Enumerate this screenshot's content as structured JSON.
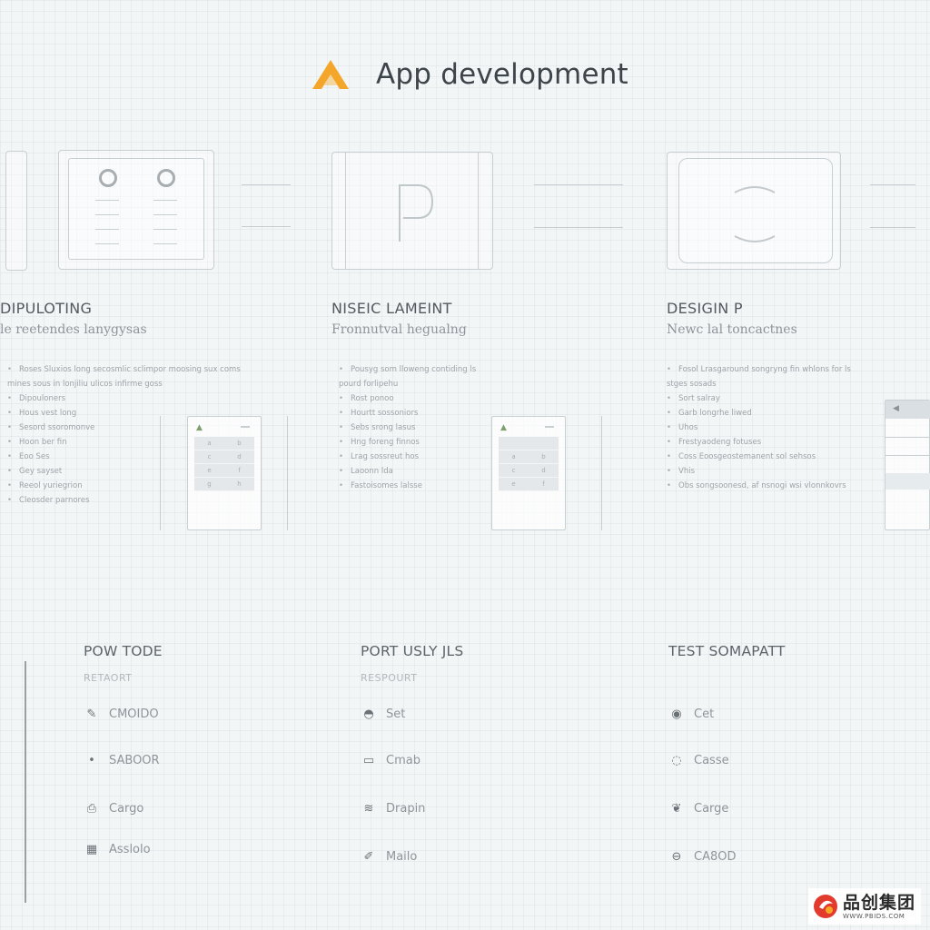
{
  "header": {
    "title": "App development",
    "logo_icon": "triangle-logo-icon",
    "accent": "#f4a62a"
  },
  "columns": [
    {
      "title": "DIPULOTING",
      "subtitle": "le reetendes lanygysas",
      "bullets": [
        "Roses Sluxios long secosmlic sclimpor moosing sux coms mines sous in lonjiliu ulicos infirme goss",
        "Dipouloners",
        "Hous vest long",
        "Sesord ssoromonve",
        "Hoon ber fin",
        "Eoo Ses",
        "Gey sayset",
        "Reeol yuriegrion",
        "Cleosder parnores"
      ]
    },
    {
      "title": "NISEIC LAMEINT",
      "subtitle": "Fronnutval hegualng",
      "bullets": [
        "Pousyg som lloweng contiding ls pourd forlipehu",
        "Rost ponoo",
        "Hourtt sossoniors",
        "Sebs srong lasus",
        "Hng foreng finnos",
        "Lrag sossreut hos",
        "Laoonn lda",
        "Fastoisomes lalsse"
      ]
    },
    {
      "title": "DESIGIN P",
      "subtitle": "Newc lal toncactnes",
      "bullets": [
        "Fosol Lrasgaround songryng fin whlons for ls stges sosads",
        "Sort salray",
        "Garb longrhe liwed",
        "Uhos",
        "Frestyaodeng fotuses",
        "Coss Eoosgeostemanent sol sehsos",
        "Vhis",
        "Obs songsoonesd, af nsnogi wsi vlonnkovrs"
      ]
    }
  ],
  "phones": [
    {
      "keys": [
        "a",
        "b",
        "c",
        "d",
        "e",
        "f",
        "g",
        "h"
      ]
    },
    {
      "keys": [
        "",
        "",
        "a",
        "b",
        "c",
        "d",
        "e",
        "f"
      ]
    }
  ],
  "sections": [
    {
      "title": "POW TODE",
      "subtitle": "RETAORT",
      "rows": [
        {
          "icon": "pencil-icon",
          "glyph": "✎",
          "label": "CMOIDO"
        },
        {
          "icon": "dot-icon",
          "glyph": "•",
          "label": "SABOOR"
        },
        {
          "icon": "printer-icon",
          "glyph": "⎙",
          "label": "Cargo"
        },
        {
          "icon": "grid-icon",
          "glyph": "▦",
          "label": "Asslolo"
        }
      ]
    },
    {
      "title": "PORT USLY JLS",
      "subtitle": "RESPOURT",
      "rows": [
        {
          "icon": "helmet-icon",
          "glyph": "◓",
          "label": "Set"
        },
        {
          "icon": "window-icon",
          "glyph": "▭",
          "label": "Cmab"
        },
        {
          "icon": "wave-icon",
          "glyph": "≋",
          "label": "Drapin"
        },
        {
          "icon": "pen-icon",
          "glyph": "✐",
          "label": "Mailo"
        }
      ]
    },
    {
      "title": "TEST SOMAPATT",
      "subtitle": "",
      "rows": [
        {
          "icon": "disc-icon",
          "glyph": "◉",
          "label": "Cet"
        },
        {
          "icon": "ring-icon",
          "glyph": "◌",
          "label": "Casse"
        },
        {
          "icon": "leaf-icon",
          "glyph": "❦",
          "label": "Carge"
        },
        {
          "icon": "circle-icon",
          "glyph": "⊖",
          "label": "CA8OD"
        }
      ]
    }
  ],
  "watermark": {
    "cn": "品创集团",
    "url": "WWW.PBIDS.COM"
  }
}
